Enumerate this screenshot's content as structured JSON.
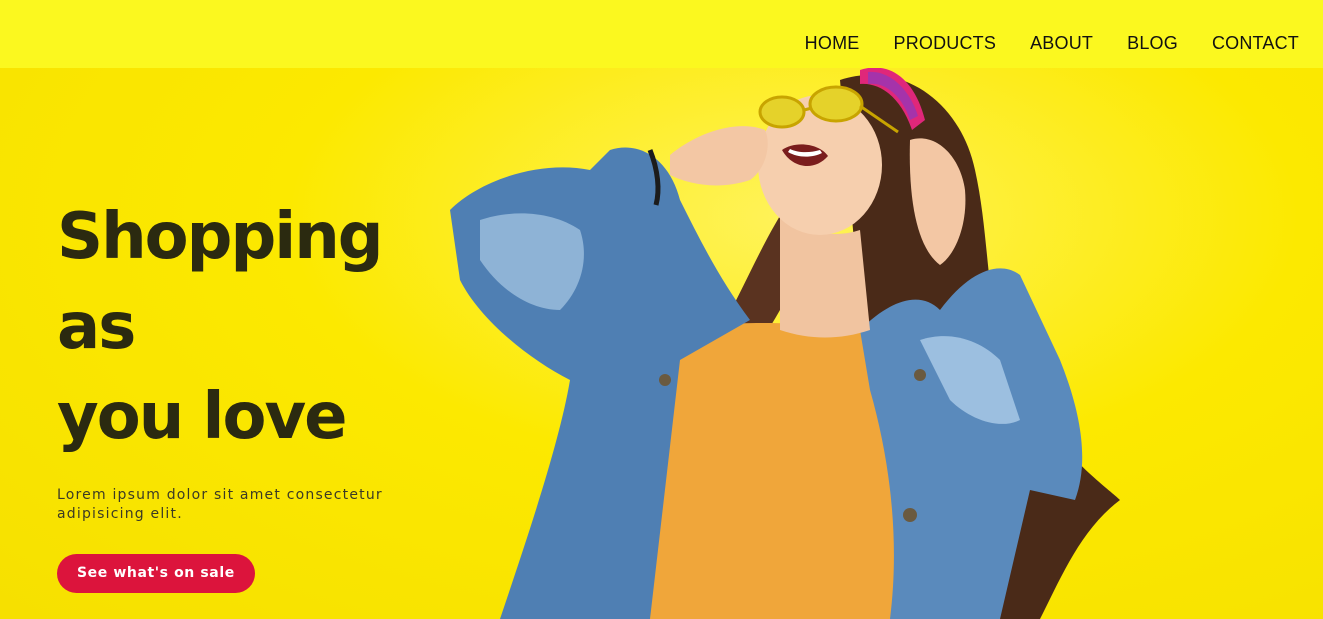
{
  "nav": {
    "items": [
      "HOME",
      "PRODUCTS",
      "ABOUT",
      "BLOG",
      "CONTACT"
    ]
  },
  "hero": {
    "title_line1": "Shopping as",
    "title_line2": "you love",
    "description": "Lorem ipsum dolor sit amet consectetur adipisicing elit.",
    "cta_label": "See what's on sale"
  },
  "colors": {
    "background": "#fbe901",
    "navbar": "#fbf81f",
    "title": "#2b2a10",
    "cta": "#dc143c",
    "nav_text": "#111111"
  },
  "image": {
    "subject": "woman-with-headphones-photo"
  }
}
